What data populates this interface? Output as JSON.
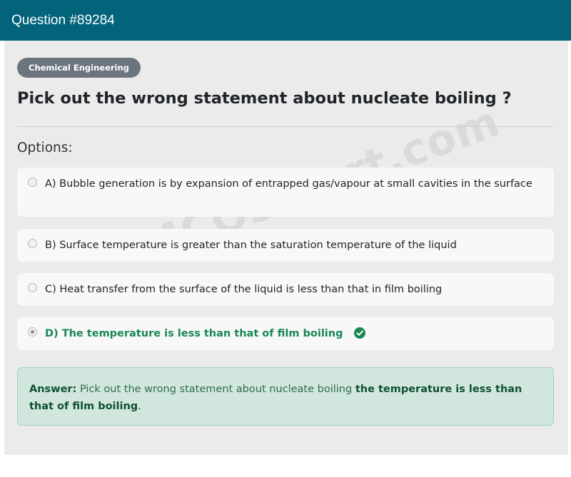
{
  "header": {
    "title": "Question #89284"
  },
  "question": {
    "category": "Chemical Engineering",
    "title": "Pick out the wrong statement about nucleate boiling ?",
    "options_label": "Options:",
    "options": [
      {
        "text": "A) Bubble generation is by expansion of entrapped gas/vapour at small cavities in the surface",
        "selected": false,
        "correct": false
      },
      {
        "text": "B) Surface temperature is greater than the saturation temperature of the liquid",
        "selected": false,
        "correct": false
      },
      {
        "text": "C) Heat transfer from the surface of the liquid is less than that in film boiling",
        "selected": false,
        "correct": false
      },
      {
        "text": "D) The temperature is less than that of film boiling",
        "selected": true,
        "correct": true
      }
    ]
  },
  "answer": {
    "label": "Answer:",
    "question_text": "Pick out the wrong statement about nucleate boiling",
    "answer_text": "the temperature is less than that of film boiling",
    "end": "."
  },
  "watermark": "MCQsAlert.com",
  "colors": {
    "header_bg": "#02637a",
    "correct": "#198754",
    "answer_bg": "#d1e7dd",
    "badge_bg": "#6c757d"
  },
  "icons": {
    "correct": "check-circle-icon"
  }
}
